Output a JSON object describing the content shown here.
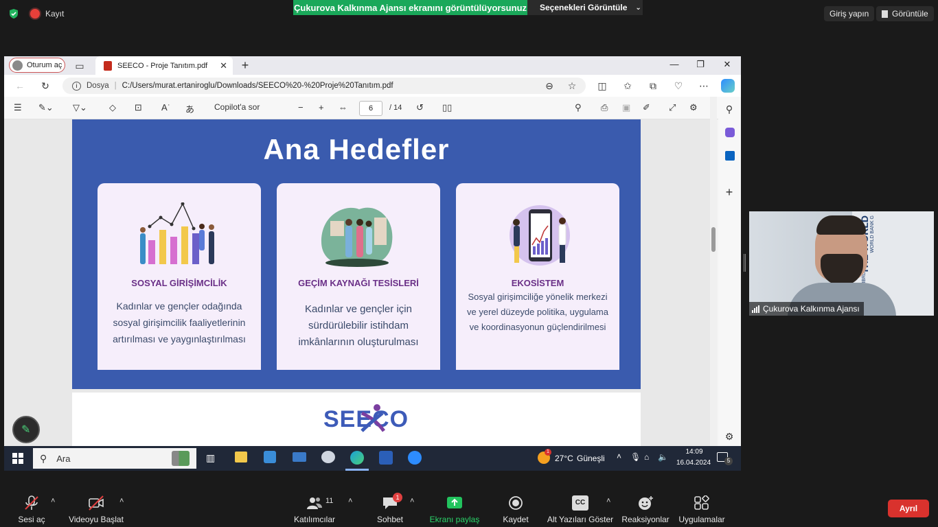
{
  "zoom_top": {
    "recording_label": "Kayıt",
    "share_banner": "Çukurova Kalkınma Ajansı ekranını görüntülüyorsunuz",
    "view_options": "Seçenekleri Görüntüle",
    "sign_in": "Giriş yapın",
    "view": "Görüntüle"
  },
  "browser": {
    "profile_label": "Oturum aç",
    "tab_title": "SEECO - Proje Tanıtım.pdf",
    "url_prefix": "Dosya",
    "url": "C:/Users/murat.ertaniroglu/Downloads/SEECO%20-%20Proje%20Tanıtım.pdf",
    "copilot_label": "Copilot'a sor",
    "current_page": "6",
    "total_pages": "/ 14"
  },
  "slide": {
    "title": "Ana Hedefler",
    "cards": [
      {
        "title": "SOSYAL GİRİŞİMCİLİK",
        "text": "Kadınlar ve gençler odağında sosyal girişimcilik faaliyetlerinin artırılması ve yaygınlaştırılması"
      },
      {
        "title": "GEÇİM KAYNAĞI TESİSLERİ",
        "text": "Kadınlar ve gençler için sürdürülebilir istihdam imkânlarının oluşturulması"
      },
      {
        "title": "EKOSİSTEM",
        "text": "Sosyal girişimciliğe yönelik merkezi ve yerel düzeyde politika, uygulama ve koordinasyonun güçlendirilmesi"
      }
    ],
    "logo_text": "SEECO"
  },
  "taskbar": {
    "search_label": "Ara",
    "weather_temp": "27°C",
    "weather_desc": "Güneşli",
    "time": "14:09",
    "date": "16.04.2024",
    "notif_count": "5",
    "weather_badge": "1"
  },
  "video": {
    "participant_name": "Çukurova Kalkınma Ajansı",
    "backdrop_text_1": "THE WORLD",
    "backdrop_text_2": "WORLD BANK G",
    "backdrop_text_3": "IBRD · IDA"
  },
  "zoom_bottom": {
    "audio": "Sesi aç",
    "video": "Videoyu Başlat",
    "participants": "Katılımcılar",
    "participants_count": "11",
    "chat": "Sohbet",
    "chat_badge": "1",
    "share": "Ekranı paylaş",
    "record": "Kaydet",
    "captions": "Alt Yazıları Göster",
    "captions_icon": "CC",
    "reactions": "Reaksiyonlar",
    "apps": "Uygulamalar",
    "leave": "Ayrıl"
  }
}
